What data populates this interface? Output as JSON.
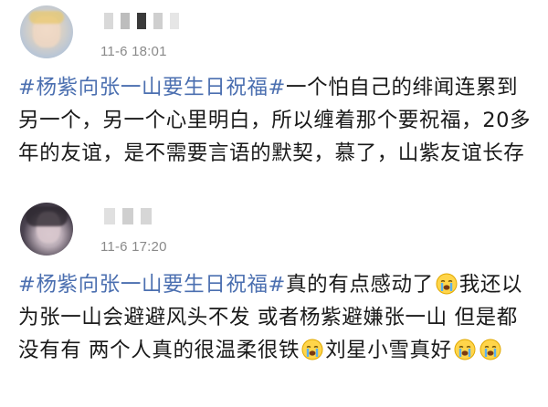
{
  "posts": [
    {
      "time": "11-6 18:01",
      "hashtag": "#杨紫向张一山要生日祝福#",
      "text": "一个怕自己的绯闻连累到另一个，另一个心里明白，所以缠着那个要祝福，20多年的友谊，是不需要言语的默契，慕了，山紫友谊长存"
    },
    {
      "time": "11-6 17:20",
      "hashtag": "#杨紫向张一山要生日祝福#",
      "text_part1": "真的有点感动了",
      "text_part2": "我还以为张一山会避避风头不发 或者杨紫避嫌张一山 但是都没有有 两个人真的很温柔很铁",
      "text_part3": "刘星小雪真好",
      "emoji": "crying-face-icon"
    }
  ],
  "colors": {
    "hashtag": "#4b6fb0",
    "time": "#8a8a8a",
    "text": "#1a1a1a"
  }
}
